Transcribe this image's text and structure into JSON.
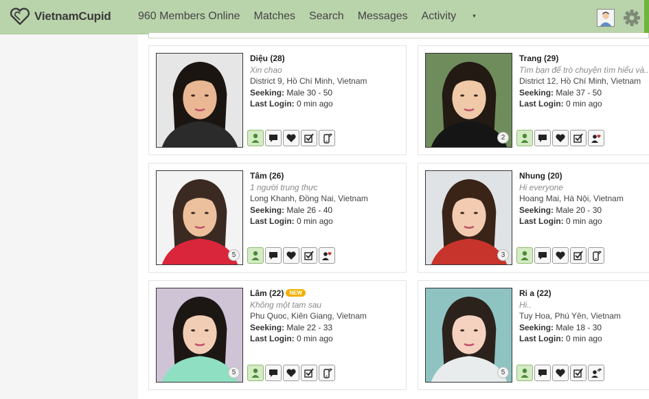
{
  "header": {
    "brand": "VietnamCupid",
    "nav": [
      "960 Members Online",
      "Matches",
      "Search",
      "Messages",
      "Activity"
    ],
    "activity_caret": "▾"
  },
  "labels": {
    "seeking": "Seeking:",
    "last_login": "Last Login:"
  },
  "profiles": [
    {
      "name": "Diệu (28)",
      "tagline": "Xin chao",
      "location": "District 9, Hồ Chí Minh, Vietnam",
      "seeking": "Male 30 - 50",
      "last_login": "0 min ago",
      "photo_count": "",
      "is_new": false,
      "badge": "",
      "last_action_icon": "phone-icon"
    },
    {
      "name": "Trang (29)",
      "tagline": "Tìm bạn để trò chuyện tìm hiểu và...",
      "location": "District 12, Hồ Chí Minh, Vietnam",
      "seeking": "Male 37 - 50",
      "last_login": "0 min ago",
      "photo_count": "2",
      "is_new": false,
      "badge": "",
      "last_action_icon": "user-heart-icon"
    },
    {
      "name": "Tâm (26)",
      "tagline": "1 người trung thực",
      "location": "Long Khanh, Đồng Nai, Vietnam",
      "seeking": "Male 26 - 40",
      "last_login": "0 min ago",
      "photo_count": "5",
      "is_new": false,
      "badge": "",
      "last_action_icon": "user-heart-icon"
    },
    {
      "name": "Nhung (20)",
      "tagline": "Hi everyone",
      "location": "Hoang Mai, Hà Nội, Vietnam",
      "seeking": "Male 20 - 30",
      "last_login": "0 min ago",
      "photo_count": "3",
      "is_new": false,
      "badge": "",
      "last_action_icon": "phone-icon"
    },
    {
      "name": "Lâm (22)",
      "tagline": "Không một tam sau",
      "location": "Phu Quoc, Kiên Giang, Vietnam",
      "seeking": "Male 22 - 33",
      "last_login": "0 min ago",
      "photo_count": "5",
      "is_new": true,
      "badge": "NEW",
      "last_action_icon": "phone-icon"
    },
    {
      "name": "Ri a (22)",
      "tagline": "Hi..",
      "location": "Tuy Hoa, Phú Yên, Vietnam",
      "seeking": "Male 18 - 30",
      "last_login": "0 min ago",
      "photo_count": "5",
      "is_new": false,
      "badge": "",
      "last_action_icon": "user-phone-icon"
    }
  ],
  "colors": {
    "topbar": "#b9d3ab",
    "accent_green": "#6fb53a",
    "new_badge": "#f1b100"
  },
  "icons": [
    "heart-logo-icon",
    "gear-icon",
    "profile-avatar-icon",
    "user-icon",
    "chat-icon",
    "heart-icon",
    "checklist-icon",
    "phone-icon",
    "user-heart-icon"
  ]
}
